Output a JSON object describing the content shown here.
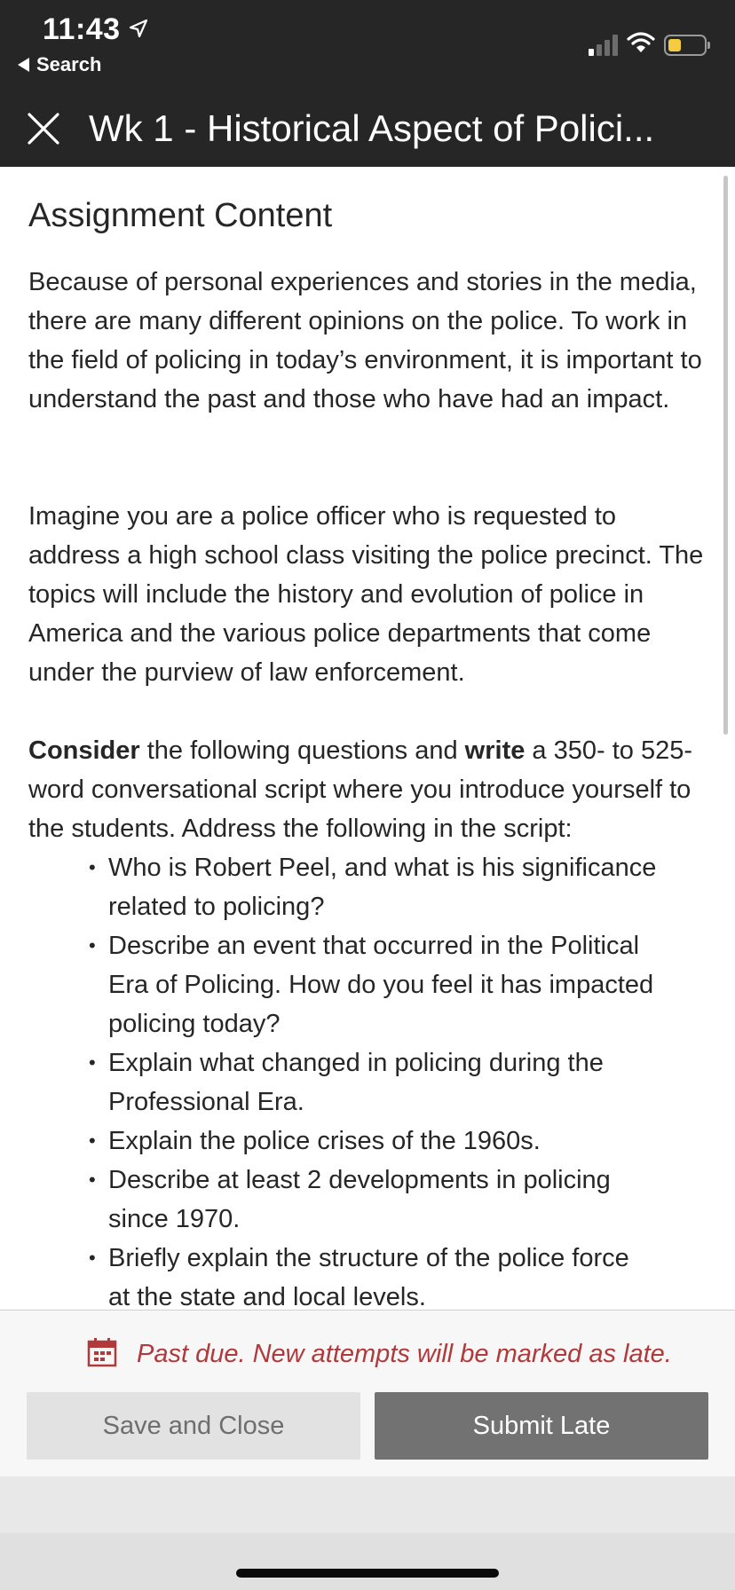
{
  "status_bar": {
    "time": "11:43",
    "back_label": "Search",
    "icons": [
      "location-arrow-icon",
      "cellular-signal-icon",
      "wifi-icon",
      "battery-icon"
    ],
    "battery_level": 0.25,
    "battery_color": "#f5cc3f"
  },
  "nav": {
    "title": "Wk 1 - Historical Aspect of Polici...",
    "close_icon": "close-icon"
  },
  "assignment": {
    "heading": "Assignment Content",
    "paragraph1": "Because of personal experiences and stories in the media, there are many different opinions on the police. To work in the field of policing in today’s environment, it is important to understand the past and those who have had an impact.",
    "paragraph2": "Imagine you are a police officer who is requested to address a high school class visiting the police precinct. The topics will include the history and evolution of police in America and the various police departments that come under the purview of law enforcement.",
    "paragraph3": {
      "bold1": "Consider",
      "text1": " the following questions and ",
      "bold2": "write",
      "text2": " a 350- to 525-word conversational script where you introduce yourself to the students. Address the following in the script:"
    },
    "bullets": [
      "Who is Robert Peel, and what is his significance related to policing?",
      "Describe an event that occurred in the Political Era of Policing. How do you feel it has impacted policing today?",
      "Explain what changed in policing during the Professional Era.",
      "Explain the police crises of the 1960s.",
      "Describe at least 2 developments in policing since 1970.",
      "Briefly explain the structure of the police force at the state and local levels."
    ]
  },
  "footer": {
    "late_notice": "Past due. New attempts will be marked as late.",
    "late_icon": "calendar-icon",
    "late_color": "#b0393b",
    "save_label": "Save and Close",
    "submit_label": "Submit Late"
  }
}
